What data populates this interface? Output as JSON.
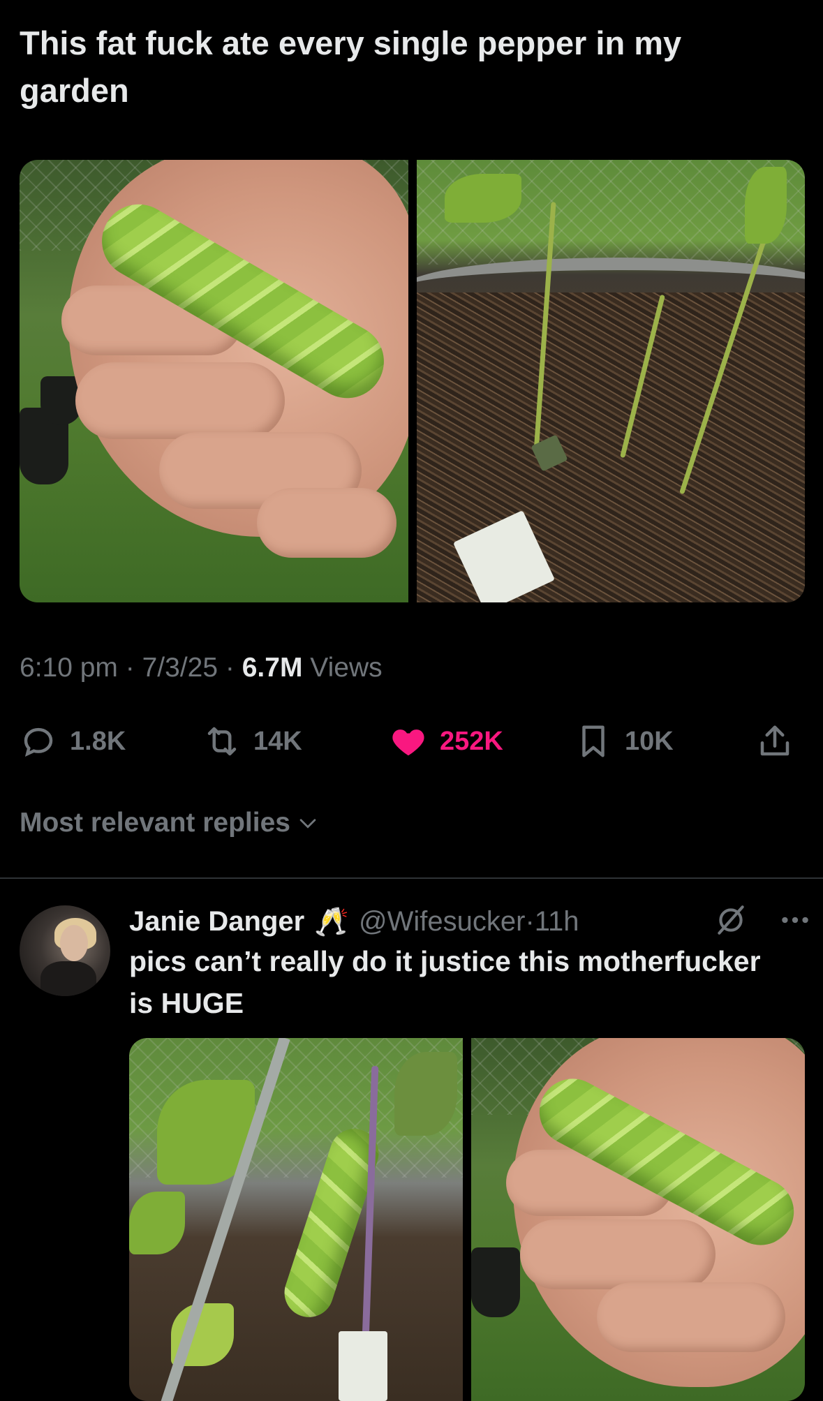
{
  "tweet": {
    "text": "This fat fuck ate every single pepper in my garden",
    "time": "6:10 pm",
    "date": "7/3/25",
    "views_count": "6.7M",
    "views_label": "Views",
    "sep": "·"
  },
  "actions": {
    "replies": "1.8K",
    "retweets": "14K",
    "likes": "252K",
    "bookmarks": "10K"
  },
  "colors": {
    "like": "#f91880",
    "muted": "#71767b",
    "text": "#e7e9ea",
    "background": "#000000"
  },
  "replies_sort": {
    "label": "Most relevant replies"
  },
  "reply": {
    "name": "Janie Danger",
    "emoji": "🥂",
    "handle": "@Wifesucker",
    "sep": "·",
    "age": "11h",
    "text": "pics can’t really do it justice this motherfucker is HUGE"
  },
  "icons": {
    "reply": "speech-bubble-icon",
    "retweet": "retweet-icon",
    "like": "heart-filled-icon",
    "bookmark": "bookmark-icon",
    "share": "share-icon",
    "sort": "chevron-down-icon",
    "grok": "grok-icon",
    "more": "more-dots-icon"
  }
}
